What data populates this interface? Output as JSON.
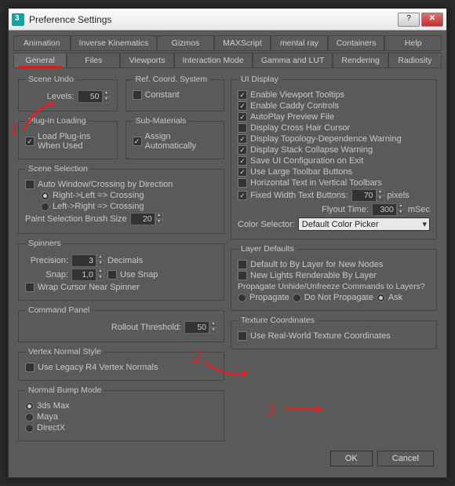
{
  "window": {
    "title": "Preference Settings"
  },
  "tabs_row1": [
    "Animation",
    "Inverse Kinematics",
    "Gizmos",
    "MAXScript",
    "mental ray",
    "Containers",
    "Help"
  ],
  "tabs_row2": [
    "General",
    "Files",
    "Viewports",
    "Interaction Mode",
    "Gamma and LUT",
    "Rendering",
    "Radiosity"
  ],
  "active_tab": "General",
  "left": {
    "scene_undo": {
      "legend": "Scene Undo",
      "levels_label": "Levels:",
      "levels": "50"
    },
    "ref_coord": {
      "legend": "Ref. Coord. System",
      "constant": "Constant"
    },
    "plugin": {
      "legend": "Plug-In Loading",
      "load": "Load Plug-ins When Used"
    },
    "submat": {
      "legend": "Sub-Materials",
      "assign": "Assign Automatically"
    },
    "scene_sel": {
      "legend": "Scene Selection",
      "auto": "Auto Window/Crossing by Direction",
      "rl": "Right->Left => Crossing",
      "lr": "Left->Right => Crossing",
      "brush_label": "Paint Selection Brush Size",
      "brush": "20"
    },
    "spinners": {
      "legend": "Spinners",
      "precision_label": "Precision:",
      "precision": "3",
      "decimals": "Decimals",
      "snap_label": "Snap:",
      "snap": "1,0",
      "use_snap": "Use Snap",
      "wrap": "Wrap Cursor Near Spinner"
    },
    "cmd": {
      "legend": "Command Panel",
      "rollout_label": "Rollout Threshold:",
      "rollout": "50"
    },
    "vns": {
      "legend": "Vertex Normal Style",
      "legacy": "Use Legacy R4 Vertex Normals"
    },
    "nbm": {
      "legend": "Normal Bump Mode",
      "opt1": "3ds Max",
      "opt2": "Maya",
      "opt3": "DirectX"
    }
  },
  "right": {
    "ui": {
      "legend": "UI Display",
      "tooltips": "Enable Viewport Tooltips",
      "caddy": "Enable Caddy Controls",
      "autoplay": "AutoPlay Preview File",
      "crosshair": "Display Cross Hair Cursor",
      "topo": "Display Topology-Dependence Warning",
      "collapse": "Display Stack Collapse Warning",
      "saveui": "Save UI Configuration on Exit",
      "largetb": "Use Large Toolbar Buttons",
      "htext": "Horizontal Text in Vertical Toolbars",
      "fixedw": "Fixed Width Text Buttons:",
      "fixedw_val": "70",
      "pixels": "pixels",
      "flyout_label": "Flyout Time:",
      "flyout": "300",
      "msec": "mSec",
      "colorsel_label": "Color Selector:",
      "colorsel": "Default Color Picker"
    },
    "layer": {
      "legend": "Layer Defaults",
      "def_by": "Default to By Layer for New Nodes",
      "newlights": "New Lights Renderable By Layer",
      "propq": "Propagate Unhide/Unfreeze Commands to Layers?",
      "r1": "Propagate",
      "r2": "Do Not Propagate",
      "r3": "Ask"
    },
    "tex": {
      "legend": "Texture Coordinates",
      "realworld": "Use Real-World Texture Coordinates"
    }
  },
  "buttons": {
    "ok": "OK",
    "cancel": "Cancel"
  },
  "annot": {
    "a1": "1",
    "a2": "2",
    "a3": "3"
  }
}
